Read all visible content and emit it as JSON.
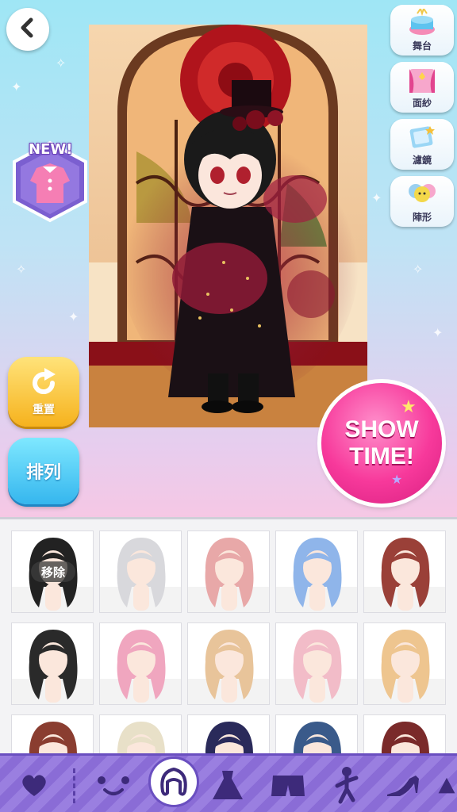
{
  "header": {
    "back_icon": "chevron-left-icon"
  },
  "new_badge": {
    "label": "NEW!",
    "icon": "new-outfit-icon"
  },
  "side_menu": [
    {
      "label": "舞台",
      "icon": "stage-icon"
    },
    {
      "label": "面紗",
      "icon": "veil-icon"
    },
    {
      "label": "濾鏡",
      "icon": "filter-icon"
    },
    {
      "label": "陣形",
      "icon": "formation-icon"
    }
  ],
  "controls": {
    "reset_label": "重置",
    "arrange_label": "排列",
    "showtime_line1": "SHOW",
    "showtime_line2": "TIME!"
  },
  "item_panel": {
    "remove_label": "移除",
    "items": [
      {
        "name": "hair-black-braid",
        "color": "#222222"
      },
      {
        "name": "hair-silver-short",
        "color": "#d8d8dc"
      },
      {
        "name": "hair-pink-wavy",
        "color": "#e8a8a8"
      },
      {
        "name": "hair-pastel-bob",
        "color": "#8fb5ea"
      },
      {
        "name": "hair-auburn-side",
        "color": "#9a4038"
      },
      {
        "name": "hair-black-long",
        "color": "#2a2a2a"
      },
      {
        "name": "hair-pink-long",
        "color": "#f0a6bf"
      },
      {
        "name": "hair-blonde-long",
        "color": "#e8c49a"
      },
      {
        "name": "hair-pink-curly",
        "color": "#f2bcc8"
      },
      {
        "name": "hair-gold-curly",
        "color": "#eec58f"
      },
      {
        "name": "hair-brown-short",
        "color": "#8a3d30"
      },
      {
        "name": "hair-cream-short",
        "color": "#e8e0c8"
      },
      {
        "name": "hair-navy-bun",
        "color": "#2a2a5a"
      },
      {
        "name": "hair-blue-short",
        "color": "#3a5a8a"
      },
      {
        "name": "hair-red-bun",
        "color": "#7a2a2a"
      }
    ]
  },
  "tabs": [
    {
      "name": "tab-favorites",
      "icon": "heart-icon"
    },
    {
      "name": "tab-face",
      "icon": "face-icon"
    },
    {
      "name": "tab-hair",
      "icon": "hair-icon",
      "active": true
    },
    {
      "name": "tab-dress",
      "icon": "dress-icon"
    },
    {
      "name": "tab-bottoms",
      "icon": "shorts-icon"
    },
    {
      "name": "tab-pose",
      "icon": "pose-icon"
    },
    {
      "name": "tab-shoes",
      "icon": "shoe-icon"
    },
    {
      "name": "tab-more",
      "icon": "hat-icon"
    }
  ],
  "colors": {
    "accent_pink": "#f7399b",
    "accent_yellow": "#f6b21d",
    "accent_blue": "#35b6ee",
    "tabbar_purple": "#8a6cd6"
  }
}
